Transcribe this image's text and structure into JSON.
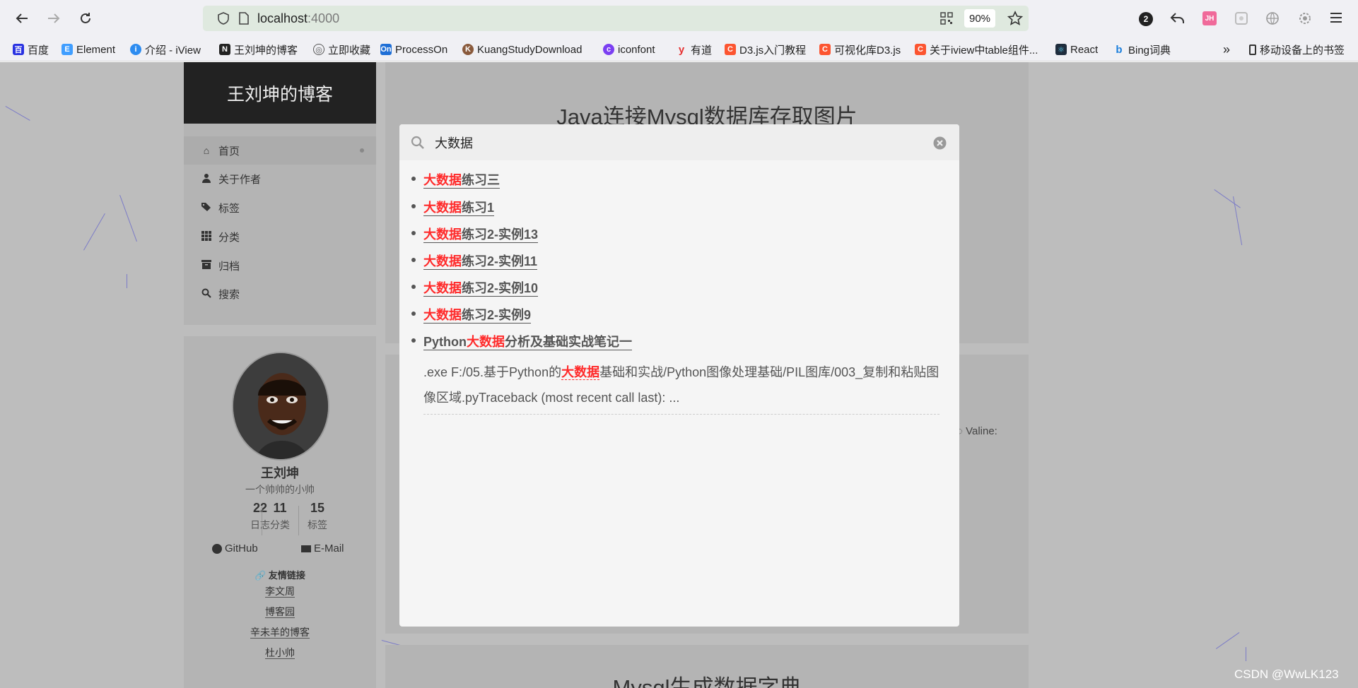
{
  "browser": {
    "url_host": "localhost",
    "url_port": ":4000",
    "zoom": "90%",
    "notification_count": "2",
    "profile_initials": "JH"
  },
  "bookmarks": [
    {
      "label": "百度",
      "icon": "baidu-icon",
      "color": "#2932e1"
    },
    {
      "label": "Element",
      "icon": "element-icon",
      "color": "#409eff"
    },
    {
      "label": "介绍 - iView",
      "icon": "iview-icon",
      "color": "#2d8cf0"
    },
    {
      "label": "王刘坤的博客",
      "icon": "blog-n-icon",
      "color": "#222222"
    },
    {
      "label": "立即收藏",
      "icon": "globe-icon",
      "color": "#555555"
    },
    {
      "label": "ProcessOn",
      "icon": "processon-icon",
      "color": "#1f6fd6"
    },
    {
      "label": "KuangStudyDownload",
      "icon": "kuangstudy-icon",
      "color": "#8a5a3c"
    },
    {
      "label": "iconfont",
      "icon": "iconfont-icon",
      "color": "#7b3ff2"
    },
    {
      "label": "有道",
      "icon": "youdao-icon",
      "color": "#e63232"
    },
    {
      "label": "D3.js入门教程",
      "icon": "csdn-icon",
      "color": "#fc5531"
    },
    {
      "label": "可视化库D3.js",
      "icon": "csdn-icon",
      "color": "#fc5531"
    },
    {
      "label": "关于iview中table组件...",
      "icon": "csdn-icon",
      "color": "#fc5531"
    },
    {
      "label": "React",
      "icon": "react-icon",
      "color": "#1f2d3d"
    },
    {
      "label": "Bing词典",
      "icon": "bing-icon",
      "color": "#1c7fdc"
    }
  ],
  "mobile_bookmarks": "移动设备上的书签",
  "sidebar": {
    "brand": "王刘坤的博客",
    "menu": [
      {
        "label": "首页",
        "icon": "home-icon"
      },
      {
        "label": "关于作者",
        "icon": "user-icon"
      },
      {
        "label": "标签",
        "icon": "tags-icon"
      },
      {
        "label": "分类",
        "icon": "grid-icon"
      },
      {
        "label": "归档",
        "icon": "archive-icon"
      },
      {
        "label": "搜索",
        "icon": "search-icon"
      }
    ]
  },
  "profile": {
    "name": "王刘坤",
    "description": "一个帅帅的小帅",
    "stats": [
      {
        "count": "22",
        "label": "日志"
      },
      {
        "count": "11",
        "label": "分类"
      },
      {
        "count": "15",
        "label": "标签"
      }
    ],
    "github": "GitHub",
    "email": "E-Mail",
    "friends_title": "友情链接",
    "friends": [
      "李文周",
      "博客园",
      "辛未羊的博客",
      "杜小帅"
    ]
  },
  "posts": {
    "first_title": "Java连接Mysql数据库存取图片",
    "valine_label": "Valine:",
    "third_title_partial": "Mysql生成数据字典"
  },
  "search": {
    "query": "大数据",
    "results": [
      {
        "highlight": "大数据",
        "rest": "练习三"
      },
      {
        "highlight": "大数据",
        "rest": "练习1"
      },
      {
        "highlight": "大数据",
        "rest": "练习2-实例13"
      },
      {
        "highlight": "大数据",
        "rest": "练习2-实例11"
      },
      {
        "highlight": "大数据",
        "rest": "练习2-实例10"
      },
      {
        "highlight": "大数据",
        "rest": "练习2-实例9"
      }
    ],
    "last_result": {
      "prefix": "Python",
      "highlight": "大数据",
      "suffix": "分析及基础实战笔记一"
    },
    "excerpt": {
      "before": ".exe F:/05.基于Python的",
      "highlight": "大数据",
      "after": "基础和实战/Python图像处理基础/PIL图库/003_复制和粘贴图像区域.pyTraceback (most recent call last): ..."
    }
  },
  "watermark": "CSDN @WwLK123"
}
